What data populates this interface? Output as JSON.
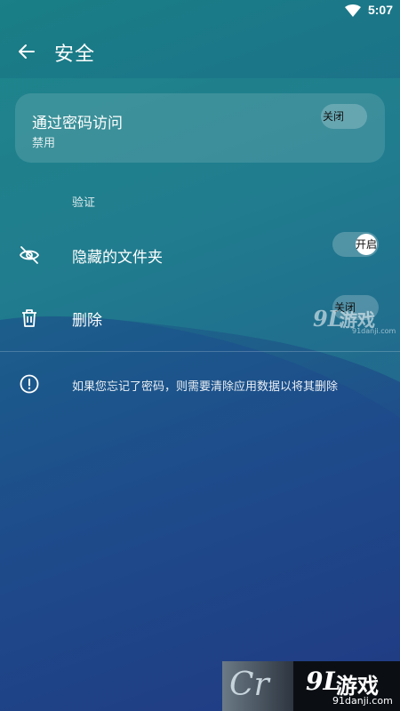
{
  "status_bar": {
    "time": "5:07",
    "icons": [
      "wifi-icon",
      "signal-icon"
    ]
  },
  "app_bar": {
    "back_icon": "arrow-back-icon",
    "title": "安全"
  },
  "password_access": {
    "title": "通过密码访问",
    "subtitle": "禁用",
    "toggle_label": "关闭",
    "enabled": false
  },
  "verification": {
    "header": "验证",
    "items": [
      {
        "icon": "eye-off-icon",
        "label": "隐藏的文件夹",
        "toggle_label": "开启",
        "enabled": true
      },
      {
        "icon": "trash-icon",
        "label": "删除",
        "toggle_label": "关闭",
        "enabled": false
      }
    ]
  },
  "info": {
    "icon": "info-circle-icon",
    "text": "如果您忘记了密码，则需要清除应用数据以将其删除"
  },
  "watermarks": {
    "mid": {
      "logo": "9L",
      "brand": "游戏",
      "domain": "91danji.com"
    },
    "bottom": {
      "left_text": "Cr",
      "logo": "9L",
      "brand": "游戏",
      "domain": "91danji.com"
    }
  },
  "colors": {
    "bg_top": "#1a7f86",
    "bg_bottom": "#23357e",
    "card_bg": "rgba(255,255,255,0.13)"
  }
}
